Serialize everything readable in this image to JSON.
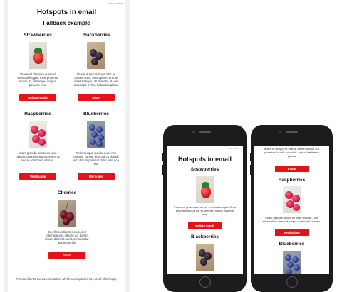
{
  "desktop": {
    "view_online": "View online",
    "title": "Hotspots in email",
    "subtitle": "Fallback example",
    "items": [
      {
        "name": "Strawberries",
        "desc": "Praesent pharetra eros vel vehicula feugiat. Cras pharetra neque mi, at semper magna posuere non.",
        "button": "Nullam mattis"
      },
      {
        "name": "Blackberries",
        "desc": "Vivamus sed tristique nibh, at cursus dolor. In tempor et erat sit amet tristique. Ut pharetra ut velit a suscipit. In hac habitasse platea",
        "button": "Etiam"
      },
      {
        "name": "Raspberries",
        "desc": "Etiam gravida auctor ex vitae blandit. Duis elementum lorem at neque commodo ultrices.",
        "button": "Vestibulum"
      },
      {
        "name": "Blueberries",
        "desc": "Pellentesque iaculis, nunc nec porttitor cursus, libero arcu blandit est, dictum pulvinar dolor ante non est.",
        "button": "Morbi nec"
      },
      {
        "name": "Cherries",
        "desc": "Sed finibus libero lectus, sed lobortis purus ultrices ac. Lorem ipsum dolor sit amet, consectetur adipiscing elit.",
        "button": "Etiam"
      }
    ],
    "footer": "Please refer to the documentation which accompanies this proof of concept."
  },
  "phone1": {
    "view_online": "View online",
    "title": "Hotspots in email",
    "heading1": "Strawberries",
    "desc1": "Praesent pharetra eros vel vehicula feugiat. Cras pharetra neque mi, at semper magna posuere non.",
    "button1": "Nullam mattis",
    "heading2": "Blackberries"
  },
  "phone2": {
    "top_desc": "dolor. In tempor et erat sit amet tristique. Ut pharetra ut velit a suscipit. In hac habitasse platea",
    "button_top": "Etiam",
    "heading1": "Raspberries",
    "desc1": "Etiam gravida auctor ex vitae blandit. Duis elementum lorem at neque commodo ultrices.",
    "button1": "Vestibulum",
    "heading2": "Blueberries"
  },
  "colors": {
    "button": "#e4131a",
    "phone_body": "#1c1c1e",
    "desktop_bg": "#f1f1f1"
  }
}
